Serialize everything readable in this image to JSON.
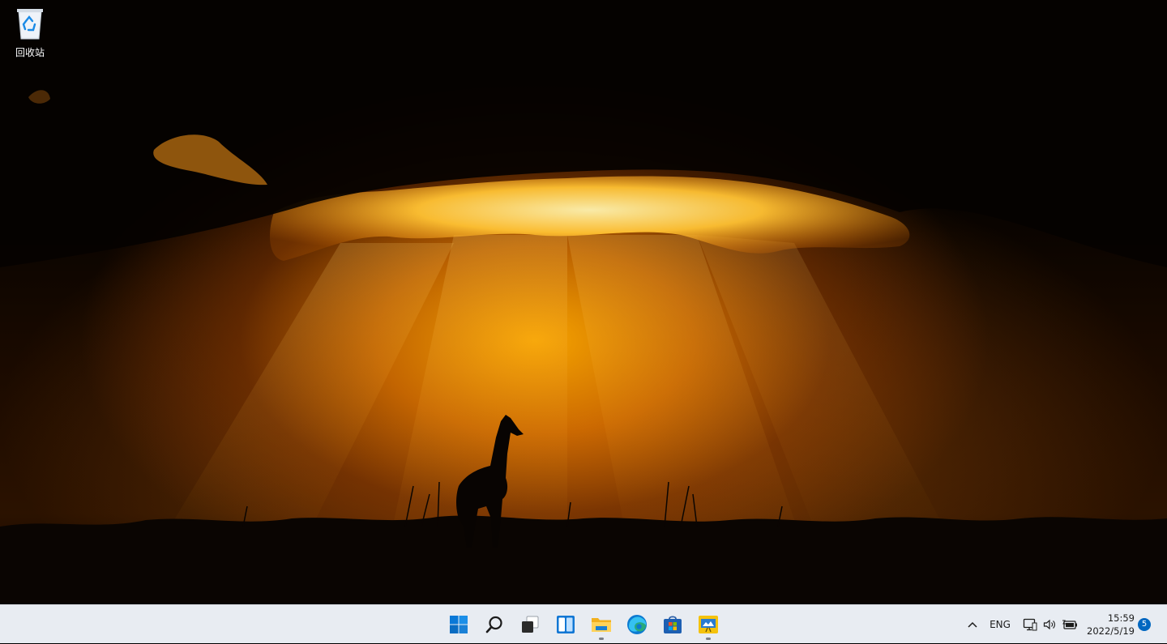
{
  "desktop": {
    "icons": [
      {
        "label": "回收站",
        "icon": "recycle-bin-icon"
      }
    ]
  },
  "taskbar": {
    "apps": [
      {
        "name": "start",
        "icon": "windows-start-icon",
        "running": false
      },
      {
        "name": "search",
        "icon": "search-icon",
        "running": false
      },
      {
        "name": "task-view",
        "icon": "task-view-icon",
        "running": false
      },
      {
        "name": "widgets",
        "icon": "widgets-icon",
        "running": false
      },
      {
        "name": "file-explorer",
        "icon": "folder-icon",
        "running": true
      },
      {
        "name": "edge",
        "icon": "edge-browser-icon",
        "running": false
      },
      {
        "name": "store",
        "icon": "store-icon",
        "running": false
      },
      {
        "name": "presentation-app",
        "icon": "presentation-icon",
        "running": true
      }
    ],
    "tray": {
      "language": "ENG",
      "time": "15:59",
      "date": "2022/5/19",
      "notification_count": "5"
    }
  }
}
